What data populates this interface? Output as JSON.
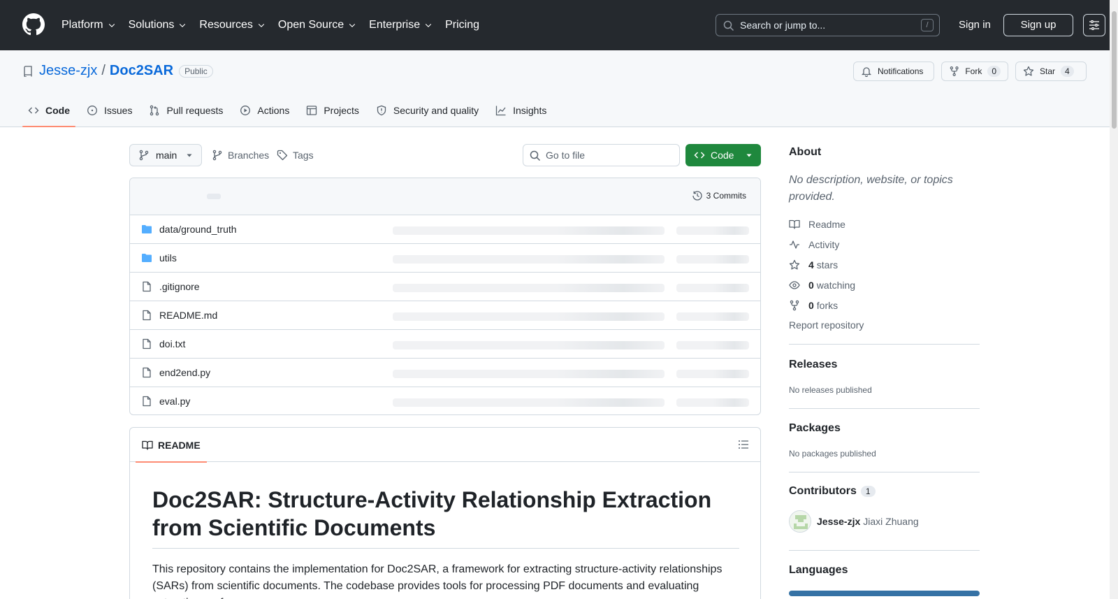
{
  "header": {
    "nav": [
      {
        "label": "Platform",
        "dropdown": true
      },
      {
        "label": "Solutions",
        "dropdown": true
      },
      {
        "label": "Resources",
        "dropdown": true
      },
      {
        "label": "Open Source",
        "dropdown": true
      },
      {
        "label": "Enterprise",
        "dropdown": true
      },
      {
        "label": "Pricing",
        "dropdown": false
      }
    ],
    "search_placeholder": "Search or jump to...",
    "search_shortcut": "/",
    "sign_in": "Sign in",
    "sign_up": "Sign up"
  },
  "repo": {
    "owner": "Jesse-zjx",
    "separator": "/",
    "name": "Doc2SAR",
    "visibility": "Public",
    "notifications_label": "Notifications",
    "fork_label": "Fork",
    "fork_count": "0",
    "star_label": "Star",
    "star_count": "4"
  },
  "tabs": [
    {
      "label": "Code",
      "icon": "code-icon",
      "active": true
    },
    {
      "label": "Issues",
      "icon": "issue-icon",
      "active": false
    },
    {
      "label": "Pull requests",
      "icon": "pull-request-icon",
      "active": false
    },
    {
      "label": "Actions",
      "icon": "play-icon",
      "active": false
    },
    {
      "label": "Projects",
      "icon": "table-icon",
      "active": false
    },
    {
      "label": "Security and quality",
      "icon": "shield-icon",
      "active": false
    },
    {
      "label": "Insights",
      "icon": "graph-icon",
      "active": false
    }
  ],
  "toolbar": {
    "branch": "main",
    "branches_label": "Branches",
    "tags_label": "Tags",
    "go_to_file": "Go to file",
    "code_button": "Code"
  },
  "files": {
    "commits_label": "3 Commits",
    "rows": [
      {
        "name": "data/ground_truth",
        "type": "folder"
      },
      {
        "name": "utils",
        "type": "folder"
      },
      {
        "name": ".gitignore",
        "type": "file"
      },
      {
        "name": "README.md",
        "type": "file"
      },
      {
        "name": "doi.txt",
        "type": "file"
      },
      {
        "name": "end2end.py",
        "type": "file"
      },
      {
        "name": "eval.py",
        "type": "file"
      }
    ]
  },
  "readme": {
    "tab_label": "README",
    "title": "Doc2SAR: Structure-Activity Relationship Extraction from Scientific Documents",
    "intro": "This repository contains the implementation for Doc2SAR, a framework for extracting structure-activity relationships (SARs) from scientific documents. The codebase provides tools for processing PDF documents and evaluating extraction performance."
  },
  "sidebar": {
    "about_title": "About",
    "about_desc": "No description, website, or topics provided.",
    "readme_link": "Readme",
    "activity_link": "Activity",
    "stars_count": "4",
    "stars_label": "stars",
    "watching_count": "0",
    "watching_label": "watching",
    "forks_count": "0",
    "forks_label": "forks",
    "report": "Report repository",
    "releases_title": "Releases",
    "releases_text": "No releases published",
    "packages_title": "Packages",
    "packages_text": "No packages published",
    "contributors_title": "Contributors",
    "contributors_count": "1",
    "contributor_login": "Jesse-zjx",
    "contributor_name": "Jiaxi Zhuang",
    "languages_title": "Languages"
  },
  "colors": {
    "header_bg": "#25292e",
    "link": "#0969da",
    "primary_button": "#1f883d",
    "tab_underline": "#fd8c73",
    "folder": "#54aeff",
    "language_python": "#3572a5"
  }
}
